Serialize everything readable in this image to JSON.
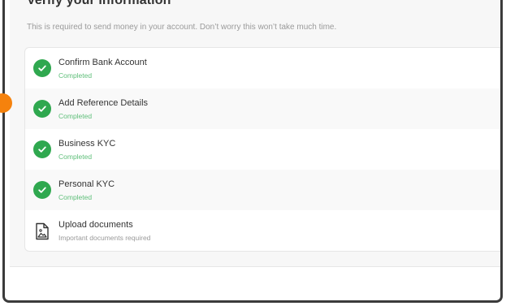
{
  "header": {
    "title": "Verify your information",
    "subtitle": "This is required to send money in your account. Don’t worry this won’t take much time."
  },
  "steps": [
    {
      "label": "Confirm Bank Account",
      "status": "Completed",
      "icon": "check-circle-icon"
    },
    {
      "label": "Add Reference Details",
      "status": "Completed",
      "icon": "check-circle-icon"
    },
    {
      "label": "Business KYC",
      "status": "Completed",
      "icon": "check-circle-icon"
    },
    {
      "label": "Personal KYC",
      "status": "Completed",
      "icon": "check-circle-icon"
    },
    {
      "label": "Upload documents",
      "status": "Important documents required",
      "icon": "document-image-icon"
    }
  ],
  "colors": {
    "success": "#2fa84f",
    "success_text": "#5fbf7a",
    "muted_text": "#9a9a9a",
    "indicator": "#f5820d"
  }
}
